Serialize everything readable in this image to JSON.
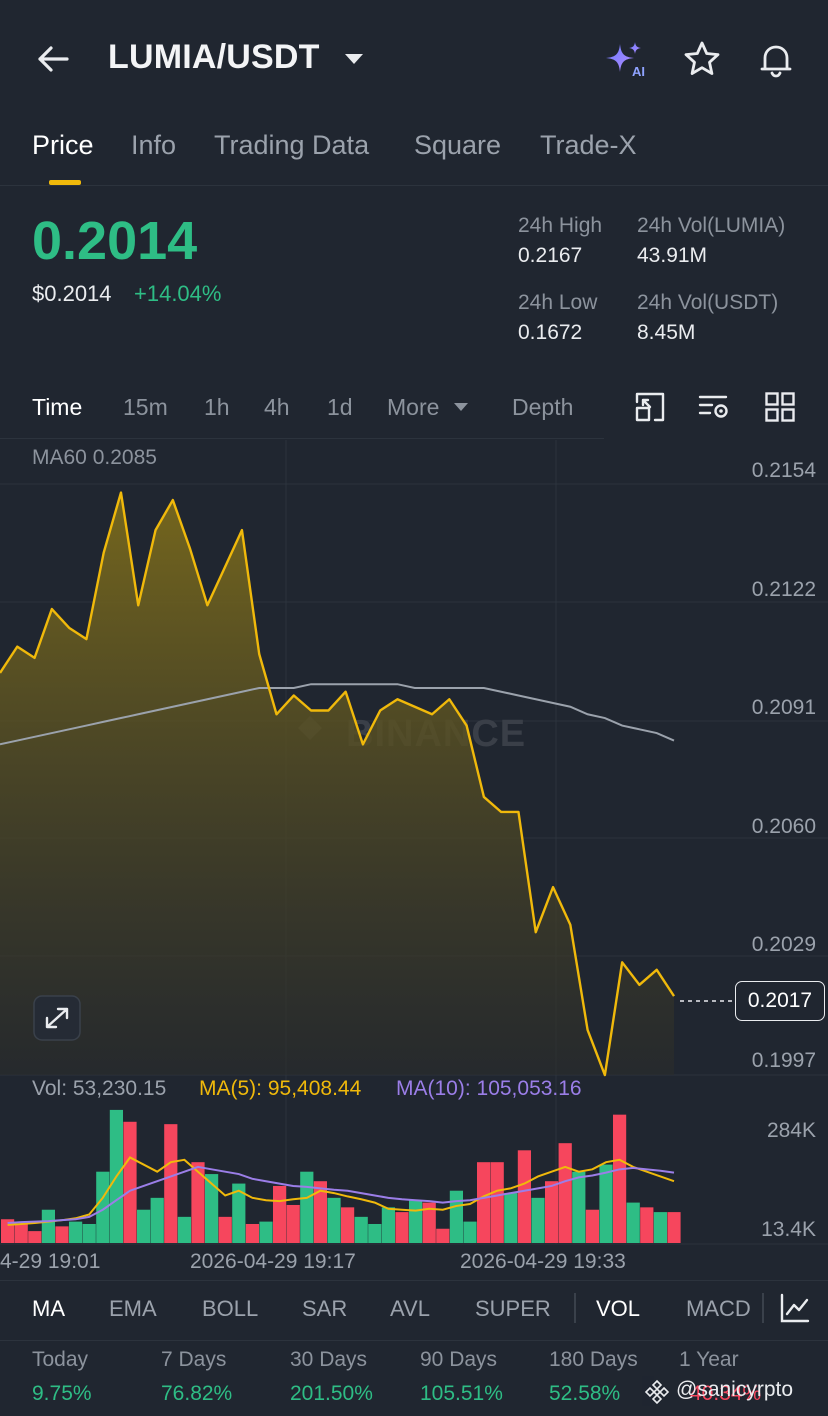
{
  "header": {
    "title": "LUMIA/USDT",
    "icons": [
      "back-arrow-icon",
      "dropdown-caret-icon",
      "ai-sparkle-icon",
      "star-icon",
      "bell-icon"
    ]
  },
  "tabs": [
    {
      "label": "Price",
      "active": true
    },
    {
      "label": "Info"
    },
    {
      "label": "Trading Data"
    },
    {
      "label": "Square"
    },
    {
      "label": "Trade-X"
    }
  ],
  "ticker": {
    "price": "0.2014",
    "usd_price": "$0.2014",
    "change": "+14.04%",
    "stats": {
      "high_label": "24h High",
      "high_value": "0.2167",
      "low_label": "24h Low",
      "low_value": "0.1672",
      "vol_base_label": "24h Vol(LUMIA)",
      "vol_base_value": "43.91M",
      "vol_quote_label": "24h Vol(USDT)",
      "vol_quote_value": "8.45M"
    }
  },
  "intervals": {
    "items": [
      "Time",
      "15m",
      "1h",
      "4h",
      "1d",
      "More",
      "Depth"
    ],
    "active": "Time"
  },
  "chart": {
    "ma60_label": "MA60 0.2085",
    "current_price_tag": "0.2017",
    "watermark": "BINANCE"
  },
  "volume": {
    "vol_label": "Vol: 53,230.15",
    "ma5_label": "MA(5): 95,408.44",
    "ma10_label": "MA(10): 105,053.16",
    "max_label": "284K",
    "min_label": "13.4K"
  },
  "chart_data": {
    "type": "area",
    "y_ticks": [
      "0.2154",
      "0.2122",
      "0.2091",
      "0.2060",
      "0.2029",
      "0.1997"
    ],
    "x_ticks": [
      "4-29 19:01",
      "2026-04-29 19:17",
      "2026-04-29 19:33"
    ],
    "ylim": [
      0.1997,
      0.2154
    ],
    "price_series": [
      0.21,
      0.2107,
      0.2104,
      0.2117,
      0.2112,
      0.2109,
      0.2132,
      0.2148,
      0.2118,
      0.2138,
      0.2146,
      0.2133,
      0.2118,
      0.2128,
      0.2138,
      0.2105,
      0.2089,
      0.2094,
      0.209,
      0.209,
      0.2095,
      0.2081,
      0.209,
      0.2093,
      0.2091,
      0.2089,
      0.2093,
      0.2086,
      0.2067,
      0.2063,
      0.2063,
      0.2031,
      0.2043,
      0.2033,
      0.2005,
      0.1993,
      0.2023,
      0.2017,
      0.2021,
      0.2014
    ],
    "ma60_series": [
      0.2081,
      0.2082,
      0.2083,
      0.2084,
      0.2085,
      0.2086,
      0.2087,
      0.2088,
      0.2089,
      0.209,
      0.2091,
      0.2092,
      0.2093,
      0.2094,
      0.2095,
      0.2096,
      0.2096,
      0.2096,
      0.2097,
      0.2097,
      0.2097,
      0.2097,
      0.2097,
      0.2097,
      0.2096,
      0.2096,
      0.2096,
      0.2096,
      0.2096,
      0.2095,
      0.2094,
      0.2093,
      0.2092,
      0.2091,
      0.2089,
      0.2088,
      0.2086,
      0.2085,
      0.2084,
      0.2082
    ],
    "volume_series": {
      "values": [
        50,
        40,
        25,
        70,
        35,
        45,
        40,
        150,
        280,
        255,
        70,
        95,
        250,
        55,
        170,
        145,
        55,
        125,
        40,
        45,
        120,
        80,
        150,
        130,
        95,
        75,
        55,
        40,
        75,
        65,
        90,
        85,
        30,
        110,
        45,
        170,
        170,
        105,
        195,
        95,
        130,
        210,
        150,
        70,
        165,
        270,
        85,
        75,
        65,
        65
      ],
      "direction": [
        "down",
        "down",
        "down",
        "up",
        "down",
        "up",
        "up",
        "up",
        "up",
        "down",
        "up",
        "up",
        "down",
        "up",
        "down",
        "up",
        "down",
        "up",
        "down",
        "up",
        "down",
        "down",
        "up",
        "down",
        "up",
        "down",
        "up",
        "up",
        "up",
        "down",
        "up",
        "down",
        "down",
        "up",
        "up",
        "down",
        "down",
        "up",
        "down",
        "up",
        "down",
        "down",
        "up",
        "down",
        "up",
        "down",
        "up",
        "down",
        "up",
        "down"
      ],
      "ma5": [
        38,
        40,
        42,
        45,
        48,
        52,
        60,
        95,
        140,
        180,
        165,
        150,
        170,
        175,
        150,
        125,
        100,
        110,
        95,
        90,
        88,
        92,
        95,
        110,
        105,
        98,
        92,
        85,
        72,
        70,
        68,
        72,
        70,
        78,
        82,
        98,
        110,
        115,
        125,
        140,
        150,
        160,
        150,
        155,
        170,
        175,
        160,
        150,
        140,
        130
      ],
      "ma10": [
        42,
        44,
        45,
        46,
        48,
        50,
        55,
        70,
        90,
        110,
        120,
        130,
        140,
        150,
        160,
        155,
        150,
        145,
        135,
        130,
        125,
        120,
        118,
        115,
        112,
        110,
        105,
        100,
        95,
        92,
        90,
        88,
        85,
        88,
        90,
        95,
        100,
        105,
        110,
        115,
        120,
        130,
        138,
        142,
        148,
        155,
        158,
        155,
        152,
        148
      ]
    }
  },
  "indicators": {
    "items": [
      "MA",
      "EMA",
      "BOLL",
      "SAR",
      "AVL",
      "SUPER",
      "VOL",
      "MACD"
    ],
    "active": [
      "MA",
      "VOL"
    ]
  },
  "performance": [
    {
      "label": "Today",
      "value": "9.75%"
    },
    {
      "label": "7 Days",
      "value": "76.82%"
    },
    {
      "label": "30 Days",
      "value": "201.50%"
    },
    {
      "label": "90 Days",
      "value": "105.51%"
    },
    {
      "label": "180 Days",
      "value": "52.58%"
    },
    {
      "label": "1 Year",
      "value": "40.34%"
    }
  ],
  "watermark_user": "@sanicyrpto",
  "colors": {
    "background": "#202630",
    "up": "#2ebd85",
    "down": "#f6465d",
    "accent": "#f0b90b",
    "ma5": "#f0b90b",
    "ma10": "#9b7ee8",
    "ma60": "#9ba2ac"
  }
}
